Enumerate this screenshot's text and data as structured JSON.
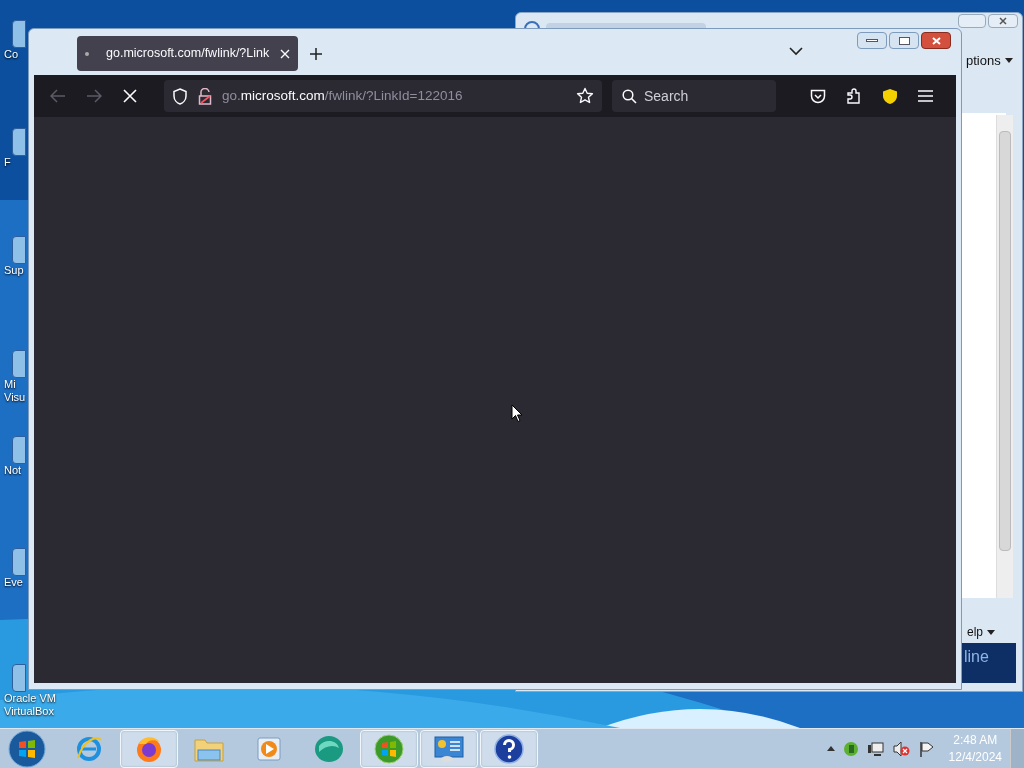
{
  "desktop_icons": [
    {
      "lines": [
        "Co"
      ]
    },
    {
      "lines": [
        "F"
      ]
    },
    {
      "lines": [
        "Sup"
      ]
    },
    {
      "lines": [
        "Mi",
        "Visu"
      ]
    },
    {
      "lines": [
        "Not"
      ]
    },
    {
      "lines": [
        "Eve"
      ]
    },
    {
      "lines": [
        "Oracle VM",
        "VirtualBox"
      ]
    }
  ],
  "back_window": {
    "menu": [
      {
        "label": "ptions"
      },
      {
        "label": "elp"
      }
    ],
    "banner": "line"
  },
  "browser": {
    "tabs": [
      {
        "title": "go.microsoft.com/fwlink/?Link",
        "selected": true
      }
    ],
    "loading": true,
    "url": {
      "domain_prefix": "go.",
      "domain": "microsoft.com",
      "path": "/fwlink/?LinkId=122016"
    },
    "search": {
      "placeholder": "Search"
    }
  },
  "taskbar": {
    "items": [
      {
        "kind": "ie",
        "selected": false
      },
      {
        "kind": "firefox",
        "selected": true
      },
      {
        "kind": "folder",
        "selected": false
      },
      {
        "kind": "media",
        "selected": false
      },
      {
        "kind": "teal",
        "selected": false
      },
      {
        "kind": "winlogo",
        "selected": true
      },
      {
        "kind": "panel",
        "selected": true
      },
      {
        "kind": "help",
        "selected": true
      }
    ],
    "clock": {
      "time": "2:48 AM",
      "date": "12/4/2024"
    }
  }
}
